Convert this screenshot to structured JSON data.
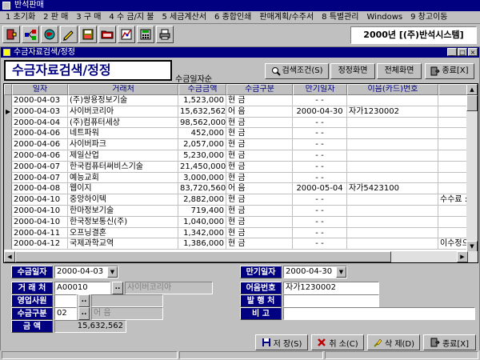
{
  "app": {
    "title": "반석판매"
  },
  "menu": [
    {
      "label": "1 초기화"
    },
    {
      "label": "2 판 매"
    },
    {
      "label": "3 구 매"
    },
    {
      "label": "4 수 금/지 불"
    },
    {
      "label": "5 세금계산서"
    },
    {
      "label": "6 종합인쇄"
    },
    {
      "label": "판매계획/수주서"
    },
    {
      "label": "8 특별관리"
    },
    {
      "label": "Windows"
    },
    {
      "label": "9 창고이동"
    }
  ],
  "toolbar": {
    "icons": [
      "exit-door-icon",
      "network-icon",
      "globe-icon",
      "pencil-icon",
      "disk-icon",
      "folder-icon",
      "chart-icon",
      "calculator-icon",
      "printer-icon"
    ],
    "company": "2000년 [(주)반석시스템]"
  },
  "child": {
    "title": "수금자료검색/정정",
    "form_title": "수금자료검색/정정",
    "sort_label": "수금일자순",
    "buttons": {
      "search": "검색조건(S)",
      "correct": "정정화면",
      "full": "전체화면",
      "close": "종료[X]"
    }
  },
  "grid": {
    "columns": [
      "일자",
      "거래처",
      "수금금액",
      "수금구분",
      "만기일자",
      "이음(카드)번호",
      ""
    ],
    "rows": [
      {
        "date": "2000-04-03",
        "client": "(주)쌍용정보기술",
        "amount": "1,523,000",
        "type": "현 금",
        "due": "-  -",
        "note": "",
        "extra": ""
      },
      {
        "date": "2000-04-03",
        "client": "사이버코리아",
        "amount": "15,632,562",
        "type": "어 음",
        "due": "2000-04-30",
        "note": "자가1230002",
        "extra": ""
      },
      {
        "date": "2000-04-04",
        "client": "(주)컴퓨터세상",
        "amount": "98,562,000",
        "type": "현 금",
        "due": "-  -",
        "note": "",
        "extra": ""
      },
      {
        "date": "2000-04-06",
        "client": "네트파워",
        "amount": "452,000",
        "type": "현 금",
        "due": "-  -",
        "note": "",
        "extra": ""
      },
      {
        "date": "2000-04-06",
        "client": "사이버파크",
        "amount": "2,057,000",
        "type": "현 금",
        "due": "-  -",
        "note": "",
        "extra": ""
      },
      {
        "date": "2000-04-06",
        "client": "제일산업",
        "amount": "5,230,000",
        "type": "현 금",
        "due": "-  -",
        "note": "",
        "extra": ""
      },
      {
        "date": "2000-04-07",
        "client": "한국컴퓨터써비스기술",
        "amount": "21,450,000",
        "type": "현 금",
        "due": "-  -",
        "note": "",
        "extra": ""
      },
      {
        "date": "2000-04-07",
        "client": "예능교회",
        "amount": "3,000,000",
        "type": "현 금",
        "due": "-  -",
        "note": "",
        "extra": ""
      },
      {
        "date": "2000-04-08",
        "client": "웹이지",
        "amount": "83,720,560",
        "type": "어 음",
        "due": "2000-05-04",
        "note": "자가5423100",
        "extra": ""
      },
      {
        "date": "2000-04-10",
        "client": "중앙하이텍",
        "amount": "2,882,000",
        "type": "현 금",
        "due": "-  -",
        "note": "",
        "extra": "수수료 :"
      },
      {
        "date": "2000-04-10",
        "client": "한마정보기술",
        "amount": "719,400",
        "type": "현 금",
        "due": "-  -",
        "note": "",
        "extra": ""
      },
      {
        "date": "2000-04-10",
        "client": "한국정보통신(주)",
        "amount": "1,040,000",
        "type": "현 금",
        "due": "-  -",
        "note": "",
        "extra": ""
      },
      {
        "date": "2000-04-11",
        "client": "오프닝결혼",
        "amount": "1,342,000",
        "type": "현 금",
        "due": "-  -",
        "note": "",
        "extra": ""
      },
      {
        "date": "2000-04-12",
        "client": "국제과학교역",
        "amount": "1,386,000",
        "type": "현 금",
        "due": "-  -",
        "note": "",
        "extra": "이수정으"
      }
    ]
  },
  "detail": {
    "labels": {
      "date": "수금일자",
      "client": "거 래 처",
      "salesperson": "영업사원",
      "type": "수금구분",
      "amount": "금    액",
      "due": "만기일자",
      "note_no": "어음번호",
      "issuer": "발 행 처",
      "remark": "비    고"
    },
    "values": {
      "date": "2000-04-03",
      "client_code": "A00010",
      "client_name": "사이버코리아",
      "salesperson_code": "",
      "salesperson_name": "",
      "type_code": "02",
      "type_name": "어 음",
      "amount": "15,632,562",
      "due": "2000-04-30",
      "note_no": "자가1230002",
      "issuer": "",
      "remark": ""
    },
    "lookup_label": ".."
  },
  "bottom": {
    "save": "저 장(S)",
    "cancel": "취 소(C)",
    "delete": "삭 제(D)",
    "close": "종료[X]"
  }
}
